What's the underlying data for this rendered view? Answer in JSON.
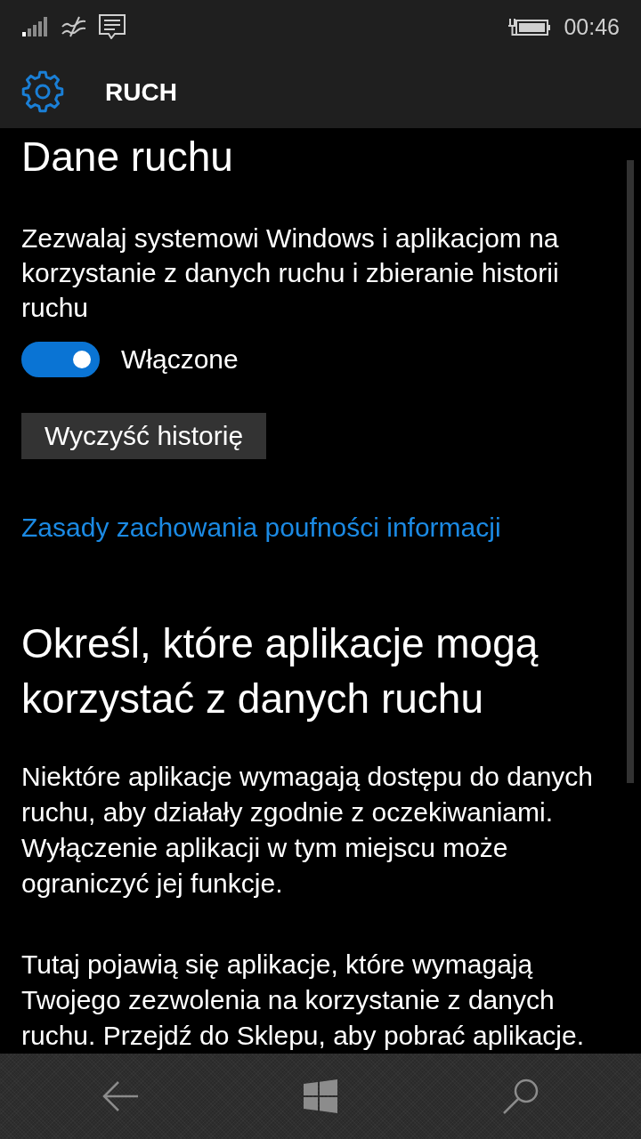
{
  "status_bar": {
    "time": "00:46"
  },
  "header": {
    "title": "RUCH"
  },
  "motion_data": {
    "heading": "Dane ruchu",
    "description": "Zezwalaj systemowi Windows i aplikacjom na korzystanie z danych ruchu i zbieranie historii ruchu",
    "toggle": {
      "on": true,
      "label": "Włączone"
    },
    "clear_button": "Wyczyść historię",
    "privacy_link": "Zasady zachowania poufności informacji"
  },
  "app_access": {
    "heading": "Określ, które aplikacje mogą korzystać z danych ruchu",
    "paragraphs": [
      "Niektóre aplikacje wymagają dostępu do danych ruchu, aby działały zgodnie z oczekiwaniami. Wyłączenie aplikacji w tym miejscu może ograniczyć jej funkcje.",
      "Tutaj pojawią się aplikacje, które wymagają Twojego zezwolenia na korzystanie z danych ruchu. Przejdź do Sklepu, aby pobrać aplikacje."
    ]
  }
}
